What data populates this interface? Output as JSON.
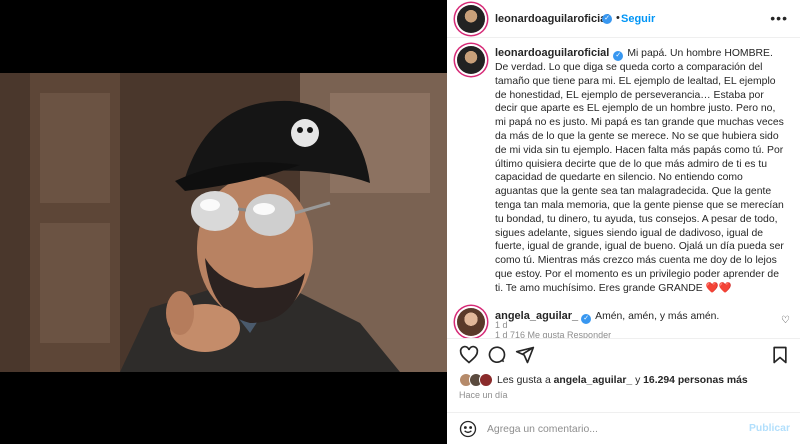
{
  "header": {
    "username": "leonardoaguilaroficial",
    "separator": "•",
    "follow_label": "Seguir",
    "more_label": "•••"
  },
  "caption": {
    "username": "leonardoaguilaroficial",
    "text": "Mi papá. Un hombre HOMBRE. De verdad. Lo que diga se queda corto a comparación del tamaño que tiene para mi. EL ejemplo de lealtad, EL ejemplo de honestidad, EL ejemplo de perseverancia… Estaba por decir que aparte es EL ejemplo de un hombre justo. Pero no, mi papá no es justo. Mi papá es tan grande que muchas veces da más de lo que la gente se merece. No se que hubiera sido de mi vida sin tu ejemplo. Hacen falta más papás como tú. Por último quisiera decirte que de lo que más admiro de ti es tu capacidad de quedarte en silencio. No entiendo como aguantas que la gente sea tan malagradecida. Que la gente tenga tan mala memoria, que la gente piense que se merecían tu bondad, tu dinero, tu ayuda, tus consejos. A pesar de todo, sigues adelante, sigues siendo igual de dadivoso, igual de fuerte, igual de grande, igual de bueno. Ojalá un día pueda ser como tú. Mientras más crezco más cuenta me doy de lo lejos que estoy. Por el momento es un privilegio poder aprender de ti. Te amo muchísimo. Eres grande GRANDE ❤️❤️",
    "time": "1 d"
  },
  "reply": {
    "username": "angela_aguilar_",
    "text": "Amén, amén, y más amén.",
    "meta": "1 d   716 Me gusta   Responder"
  },
  "actions": {
    "like_icon": "heart-icon",
    "comment_icon": "comment-icon",
    "share_icon": "share-icon",
    "save_icon": "bookmark-icon"
  },
  "likes": {
    "prefix": "Les gusta a",
    "user": "angela_aguilar_",
    "middle": "y",
    "count": "16.294 personas más"
  },
  "timestamp": "Hace un día",
  "composer": {
    "placeholder": "Agrega un comentario...",
    "publish_label": "Publicar"
  },
  "colors": {
    "accent": "#0095f6",
    "verified": "#3897f0",
    "muted": "#8e8e8e",
    "publish_disabled": "#b2dffc"
  }
}
